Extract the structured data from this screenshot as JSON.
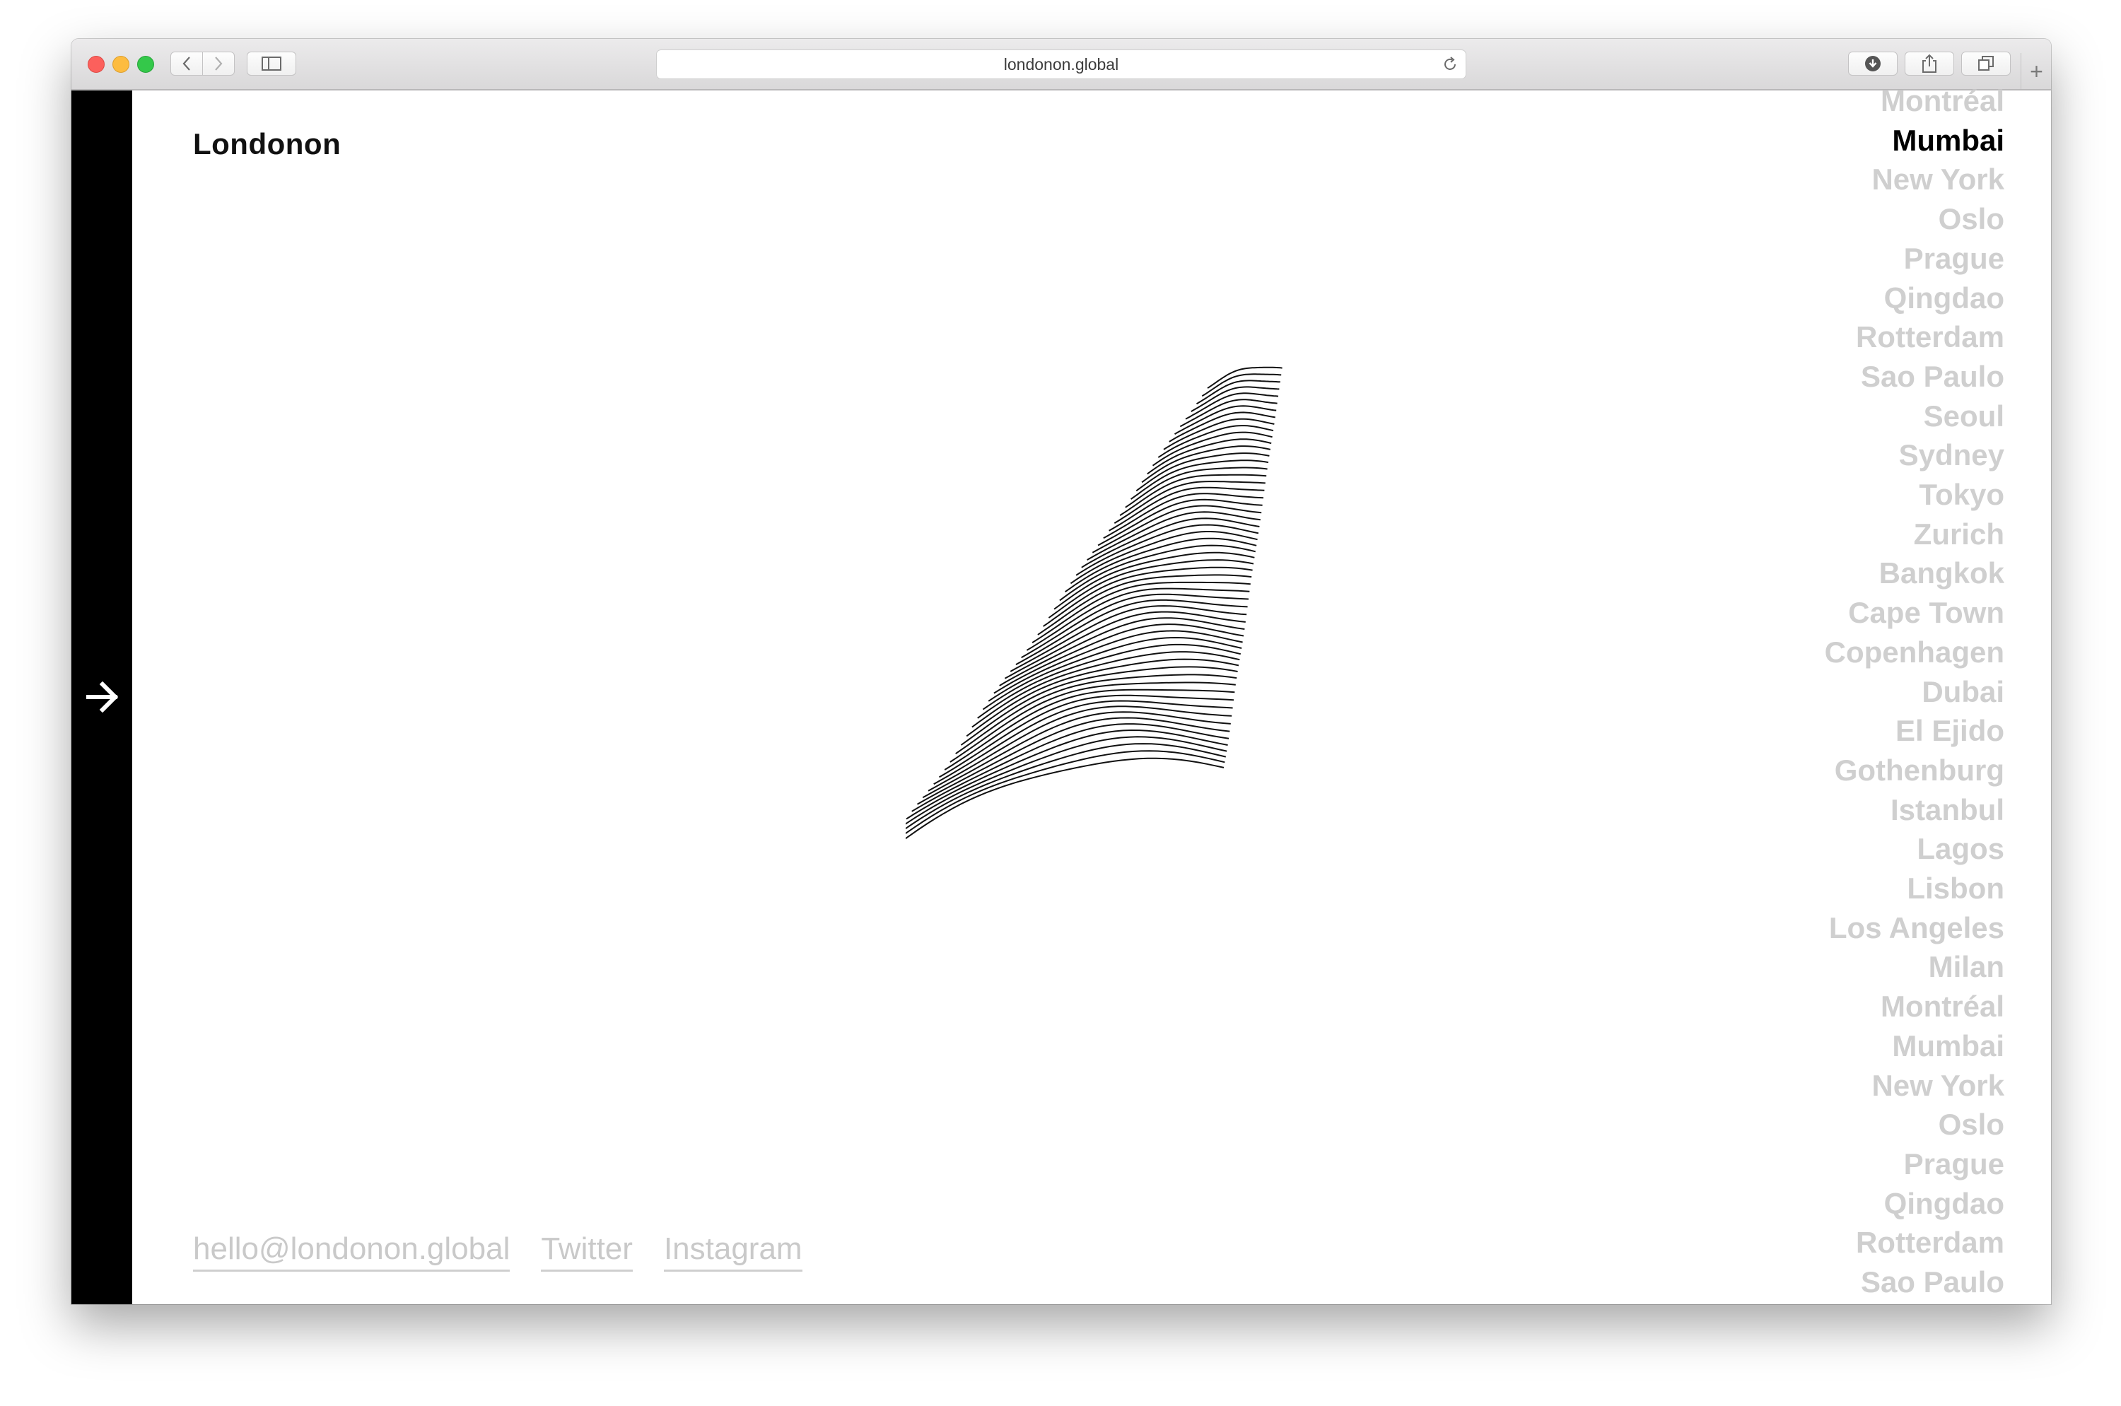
{
  "browser": {
    "url": "londonon.global"
  },
  "site": {
    "logo": "Londonon",
    "footer": {
      "email": "hello@londonon.global",
      "twitter": "Twitter",
      "instagram": "Instagram"
    },
    "cities": [
      {
        "name": "Montréal",
        "active": false
      },
      {
        "name": "Mumbai",
        "active": true
      },
      {
        "name": "New York",
        "active": false
      },
      {
        "name": "Oslo",
        "active": false
      },
      {
        "name": "Prague",
        "active": false
      },
      {
        "name": "Qingdao",
        "active": false
      },
      {
        "name": "Rotterdam",
        "active": false
      },
      {
        "name": "Sao Paulo",
        "active": false
      },
      {
        "name": "Seoul",
        "active": false
      },
      {
        "name": "Sydney",
        "active": false
      },
      {
        "name": "Tokyo",
        "active": false
      },
      {
        "name": "Zurich",
        "active": false
      },
      {
        "name": "Bangkok",
        "active": false
      },
      {
        "name": "Cape Town",
        "active": false
      },
      {
        "name": "Copenhagen",
        "active": false
      },
      {
        "name": "Dubai",
        "active": false
      },
      {
        "name": "El Ejido",
        "active": false
      },
      {
        "name": "Gothenburg",
        "active": false
      },
      {
        "name": "Istanbul",
        "active": false
      },
      {
        "name": "Lagos",
        "active": false
      },
      {
        "name": "Lisbon",
        "active": false
      },
      {
        "name": "Los Angeles",
        "active": false
      },
      {
        "name": "Milan",
        "active": false
      },
      {
        "name": "Montréal",
        "active": false
      },
      {
        "name": "Mumbai",
        "active": false
      },
      {
        "name": "New York",
        "active": false
      },
      {
        "name": "Oslo",
        "active": false
      },
      {
        "name": "Prague",
        "active": false
      },
      {
        "name": "Qingdao",
        "active": false
      },
      {
        "name": "Rotterdam",
        "active": false
      },
      {
        "name": "Sao Paulo",
        "active": false
      }
    ]
  },
  "colors": {
    "accent": "#000000",
    "inactive_city": "#cfcfcf",
    "footer_link": "#c9c9c9"
  },
  "icons": {
    "next": "arrow-right-icon"
  }
}
